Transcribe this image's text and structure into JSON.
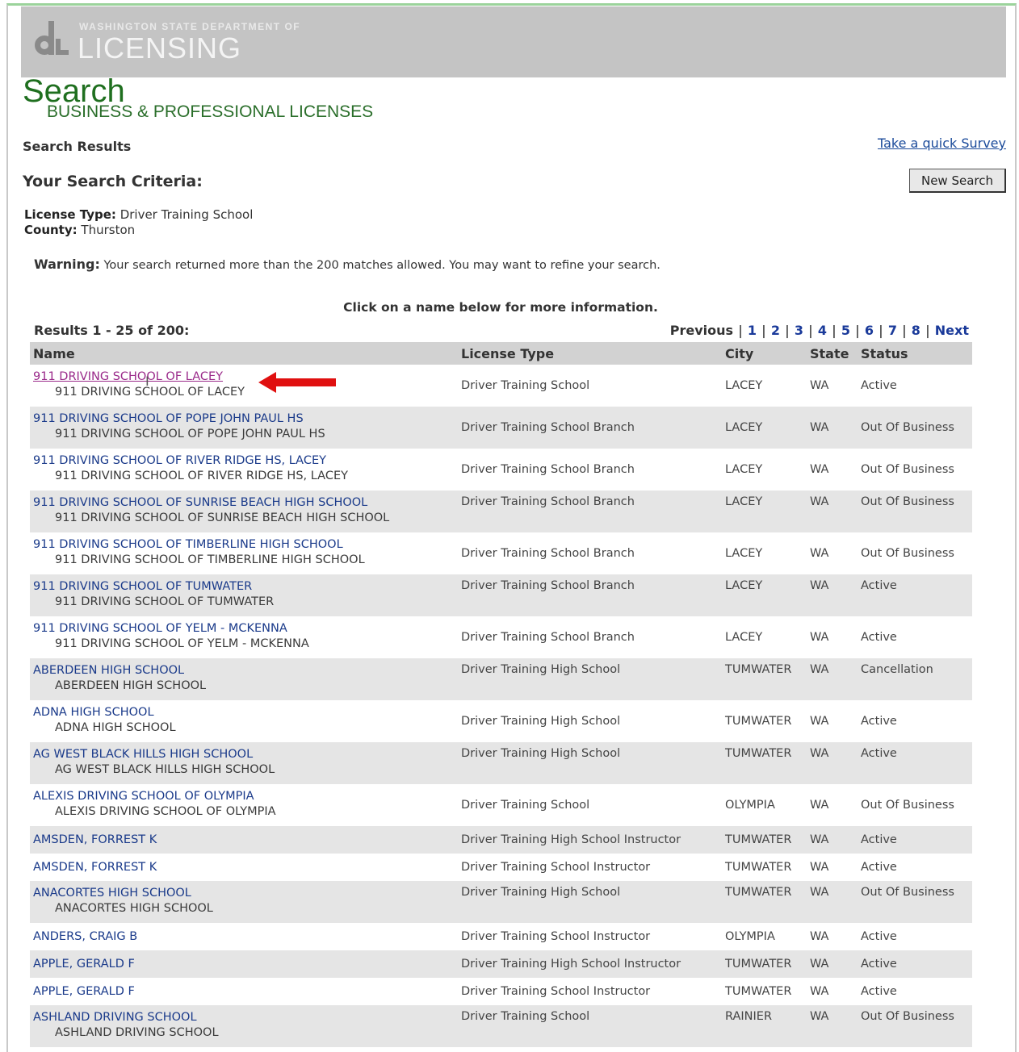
{
  "header": {
    "dept_line": "WASHINGTON STATE DEPARTMENT OF",
    "logo_text": "LICENSING",
    "title": "Search",
    "subtitle": "BUSINESS & PROFESSIONAL LICENSES"
  },
  "page": {
    "results_heading": "Search Results",
    "survey_link": "Take a quick Survey",
    "criteria_heading": "Your Search Criteria:",
    "new_search_label": "New Search"
  },
  "criteria": {
    "license_type_label": "License Type:",
    "license_type_value": "Driver Training School",
    "county_label": "County:",
    "county_value": "Thurston"
  },
  "warning": {
    "label": "Warning:",
    "text": "Your search returned more than the 200 matches allowed. You may want to refine your search."
  },
  "instructions": "Click on a name below for more information.",
  "results_count": "Results 1 - 25 of 200:",
  "pager": {
    "previous": "Previous",
    "pages": [
      "1",
      "2",
      "3",
      "4",
      "5",
      "6",
      "7",
      "8"
    ],
    "next": "Next"
  },
  "table": {
    "headers": [
      "Name",
      "License Type",
      "City",
      "State",
      "Status"
    ],
    "rows": [
      {
        "name": "911 DRIVING SCHOOL OF LACEY",
        "sub": "911 DRIVING SCHOOL OF LACEY",
        "type": "Driver Training School",
        "city": "LACEY",
        "state": "WA",
        "status": "Active",
        "visited": true
      },
      {
        "name": "911 DRIVING SCHOOL OF POPE JOHN PAUL HS",
        "sub": "911 DRIVING SCHOOL OF POPE JOHN PAUL HS",
        "type": "Driver Training School Branch",
        "city": "LACEY",
        "state": "WA",
        "status": "Out Of Business"
      },
      {
        "name": "911 DRIVING SCHOOL OF RIVER RIDGE HS, LACEY",
        "sub": "911 DRIVING SCHOOL OF RIVER RIDGE HS, LACEY",
        "type": "Driver Training School Branch",
        "city": "LACEY",
        "state": "WA",
        "status": "Out Of Business"
      },
      {
        "name": "911 DRIVING SCHOOL OF SUNRISE BEACH HIGH SCHOOL",
        "sub": "911 DRIVING SCHOOL OF SUNRISE BEACH HIGH SCHOOL",
        "type": "Driver Training School Branch",
        "city": "LACEY",
        "state": "WA",
        "status": "Out Of Business"
      },
      {
        "name": "911 DRIVING SCHOOL OF TIMBERLINE HIGH SCHOOL",
        "sub": "911 DRIVING SCHOOL OF TIMBERLINE HIGH SCHOOL",
        "type": "Driver Training School Branch",
        "city": "LACEY",
        "state": "WA",
        "status": "Out Of Business"
      },
      {
        "name": "911 DRIVING SCHOOL OF TUMWATER",
        "sub": "911 DRIVING SCHOOL OF TUMWATER",
        "type": "Driver Training School Branch",
        "city": "LACEY",
        "state": "WA",
        "status": "Active"
      },
      {
        "name": "911 DRIVING SCHOOL OF YELM - MCKENNA",
        "sub": "911 DRIVING SCHOOL OF YELM - MCKENNA",
        "type": "Driver Training School Branch",
        "city": "LACEY",
        "state": "WA",
        "status": "Active"
      },
      {
        "name": "ABERDEEN HIGH SCHOOL",
        "sub": "ABERDEEN HIGH SCHOOL",
        "type": "Driver Training High School",
        "city": "TUMWATER",
        "state": "WA",
        "status": "Cancellation"
      },
      {
        "name": "ADNA HIGH SCHOOL",
        "sub": "ADNA HIGH SCHOOL",
        "type": "Driver Training High School",
        "city": "TUMWATER",
        "state": "WA",
        "status": "Active"
      },
      {
        "name": "AG WEST BLACK HILLS HIGH SCHOOL",
        "sub": "AG WEST BLACK HILLS HIGH SCHOOL",
        "type": "Driver Training High School",
        "city": "TUMWATER",
        "state": "WA",
        "status": "Active"
      },
      {
        "name": "ALEXIS DRIVING SCHOOL OF OLYMPIA",
        "sub": "ALEXIS DRIVING SCHOOL OF OLYMPIA",
        "type": "Driver Training School",
        "city": "OLYMPIA",
        "state": "WA",
        "status": "Out Of Business"
      },
      {
        "name": "AMSDEN, FORREST K",
        "sub": "",
        "type": "Driver Training High School Instructor",
        "city": "TUMWATER",
        "state": "WA",
        "status": "Active"
      },
      {
        "name": "AMSDEN, FORREST K",
        "sub": "",
        "type": "Driver Training School Instructor",
        "city": "TUMWATER",
        "state": "WA",
        "status": "Active"
      },
      {
        "name": "ANACORTES HIGH SCHOOL",
        "sub": "ANACORTES HIGH SCHOOL",
        "type": "Driver Training High School",
        "city": "TUMWATER",
        "state": "WA",
        "status": "Out Of Business"
      },
      {
        "name": "ANDERS, CRAIG B",
        "sub": "",
        "type": "Driver Training School Instructor",
        "city": "OLYMPIA",
        "state": "WA",
        "status": "Active"
      },
      {
        "name": "APPLE, GERALD F",
        "sub": "",
        "type": "Driver Training High School Instructor",
        "city": "TUMWATER",
        "state": "WA",
        "status": "Active"
      },
      {
        "name": "APPLE, GERALD F",
        "sub": "",
        "type": "Driver Training School Instructor",
        "city": "TUMWATER",
        "state": "WA",
        "status": "Active"
      },
      {
        "name": "ASHLAND DRIVING SCHOOL",
        "sub": "ASHLAND DRIVING SCHOOL",
        "type": "Driver Training School",
        "city": "RAINIER",
        "state": "WA",
        "status": "Out Of Business"
      }
    ]
  },
  "colors": {
    "link": "#1a3a8a",
    "visited_link": "#9a2a8a",
    "brand_green": "#1f6f1f",
    "annotation_arrow": "#e01010"
  }
}
